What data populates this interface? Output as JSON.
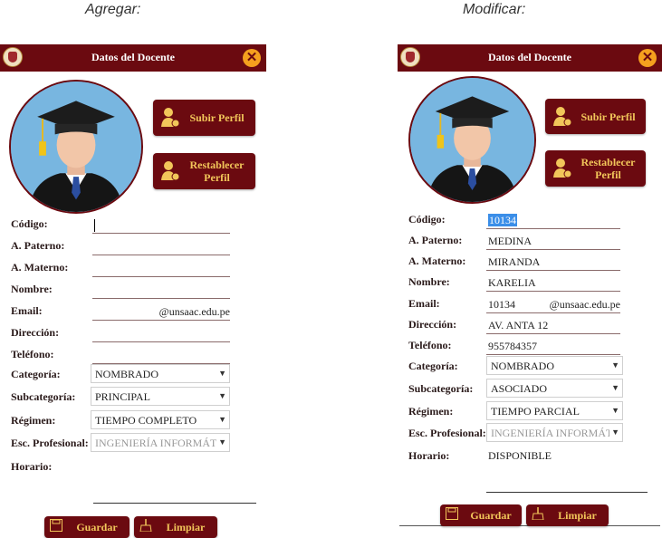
{
  "captions": {
    "add": "Agregar:",
    "edit": "Modificar:"
  },
  "dialog": {
    "title": "Datos del Docente"
  },
  "buttons": {
    "upload": "Subir Perfil",
    "reset_line1": "Restablecer",
    "reset_line2": "Perfil",
    "save": "Guardar",
    "clear": "Limpiar"
  },
  "labels": {
    "codigo": "Código:",
    "paterno": "A. Paterno:",
    "materno": "A. Materno:",
    "nombre": "Nombre:",
    "email": "Email:",
    "direccion": "Dirección:",
    "telefono": "Teléfono:",
    "categoria": "Categoría:",
    "subcategoria": "Subcategoría:",
    "regimen": "Régimen:",
    "escuela": "Esc. Profesional:",
    "horario": "Horario:"
  },
  "email_domain": "@unsaac.edu.pe",
  "add_form": {
    "codigo": "",
    "paterno": "",
    "materno": "",
    "nombre": "",
    "email": "",
    "direccion": "",
    "telefono": "",
    "categoria": "NOMBRADO",
    "subcategoria": "PRINCIPAL",
    "regimen": "TIEMPO COMPLETO",
    "escuela": "INGENIERÍA INFORMÁTI",
    "horario": ""
  },
  "edit_form": {
    "codigo": "10134",
    "paterno": "MEDINA",
    "materno": "MIRANDA",
    "nombre": "KARELIA",
    "email": "10134",
    "direccion": "AV. ANTA 12",
    "telefono": "955784357",
    "categoria": "NOMBRADO",
    "subcategoria": "ASOCIADO",
    "regimen": "TIEMPO PARCIAL",
    "escuela": "INGENIERÍA INFORMÁTI",
    "horario": "DISPONIBLE"
  },
  "icons": {
    "close": "close-icon",
    "upload": "user-upload-icon",
    "reset": "user-reset-icon",
    "save": "save-icon",
    "clear": "broom-icon",
    "dropdown": "dropdown-arrow-icon"
  },
  "colors": {
    "primary": "#6b0a10",
    "button_text": "#f2c65a",
    "close": "#f5a01e",
    "avatar_bg": "#78b6e0",
    "selection": "#3b8ee8"
  }
}
